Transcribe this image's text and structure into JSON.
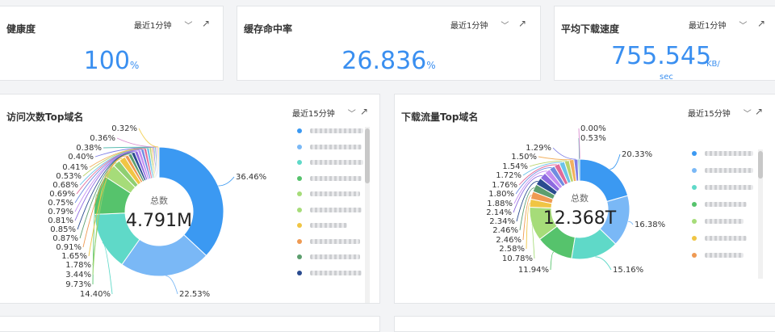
{
  "cards": {
    "health": {
      "title": "健康度",
      "range": "最近1分钟",
      "value": "100",
      "unit": "%"
    },
    "cache": {
      "title": "缓存命中率",
      "range": "最近1分钟",
      "value": "26.836",
      "unit": "%"
    },
    "speed": {
      "title": "平均下载速度",
      "range": "最近1分钟",
      "value": "755.545",
      "unit_line1": "KB/",
      "unit_line2": "sec"
    }
  },
  "visits": {
    "title": "访问次数Top域名",
    "range": "最近15分钟",
    "center_label": "总数",
    "center_value": "4.791M"
  },
  "traffic": {
    "title": "下载流量Top域名",
    "range": "最近15分钟",
    "center_label": "总数",
    "center_value": "12.368T"
  },
  "icons": {
    "chevron": "chevron-down-icon",
    "expand": "expand-arrow-icon"
  },
  "chart_data": [
    {
      "type": "pie",
      "title": "访问次数Top域名",
      "labels": [
        "36.46%",
        "22.53%",
        "14.40%",
        "9.73%",
        "3.44%",
        "1.78%",
        "1.65%",
        "0.91%",
        "0.87%",
        "0.85%",
        "0.81%",
        "0.79%",
        "0.75%",
        "0.69%",
        "0.68%",
        "0.53%",
        "0.41%",
        "0.40%",
        "0.38%",
        "0.36%",
        "0.32%"
      ],
      "values": [
        36.46,
        22.53,
        14.4,
        9.73,
        3.44,
        1.78,
        1.65,
        0.91,
        0.87,
        0.85,
        0.81,
        0.79,
        0.75,
        0.69,
        0.68,
        0.53,
        0.41,
        0.4,
        0.38,
        0.36,
        0.32
      ],
      "colors": [
        "#3b99f2",
        "#7ab8f6",
        "#5fd9c8",
        "#56c36c",
        "#a6dc79",
        "#8fcf72",
        "#f0c544",
        "#ef9a53",
        "#5c9e6e",
        "#2a4b8f",
        "#8d6ae0",
        "#c58ff1",
        "#6f8ce0",
        "#e06b9a",
        "#6cc3e9",
        "#b9d36b",
        "#f2b05e",
        "#7e7ee6",
        "#5bbdb1",
        "#d98fd0",
        "#f4d35e"
      ],
      "center_label": "总数",
      "center_value": "4.791M"
    },
    {
      "type": "pie",
      "title": "下载流量Top域名",
      "labels": [
        "20.33%",
        "16.38%",
        "15.16%",
        "11.94%",
        "10.78%",
        "2.58%",
        "2.46%",
        "2.46%",
        "2.34%",
        "2.14%",
        "1.88%",
        "1.80%",
        "1.76%",
        "1.72%",
        "1.54%",
        "1.50%",
        "1.29%",
        "0.53%",
        "0.00%"
      ],
      "values": [
        20.33,
        16.38,
        15.16,
        11.94,
        10.78,
        2.58,
        2.46,
        2.46,
        2.34,
        2.14,
        1.88,
        1.8,
        1.76,
        1.72,
        1.54,
        1.5,
        1.29,
        0.53,
        0.0
      ],
      "colors": [
        "#3b99f2",
        "#7ab8f6",
        "#5fd9c8",
        "#56c36c",
        "#a6dc79",
        "#f0c544",
        "#ef9a53",
        "#5c9e6e",
        "#2a4b8f",
        "#8d6ae0",
        "#c58ff1",
        "#6f8ce0",
        "#e06b9a",
        "#6cc3e9",
        "#b9d36b",
        "#f2b05e",
        "#7e7ee6",
        "#5bbdb1",
        "#d98fd0"
      ],
      "center_label": "总数",
      "center_value": "12.368T"
    }
  ],
  "legend_colors": {
    "visits": [
      "#3b99f2",
      "#7ab8f6",
      "#5fd9c8",
      "#56c36c",
      "#a6dc79",
      "#a6dc79",
      "#f0c544",
      "#ef9a53",
      "#5c9e6e",
      "#2a4b8f"
    ],
    "traffic": [
      "#3b99f2",
      "#7ab8f6",
      "#5fd9c8",
      "#56c36c",
      "#a6dc79",
      "#f0c544",
      "#ef9a53"
    ]
  }
}
